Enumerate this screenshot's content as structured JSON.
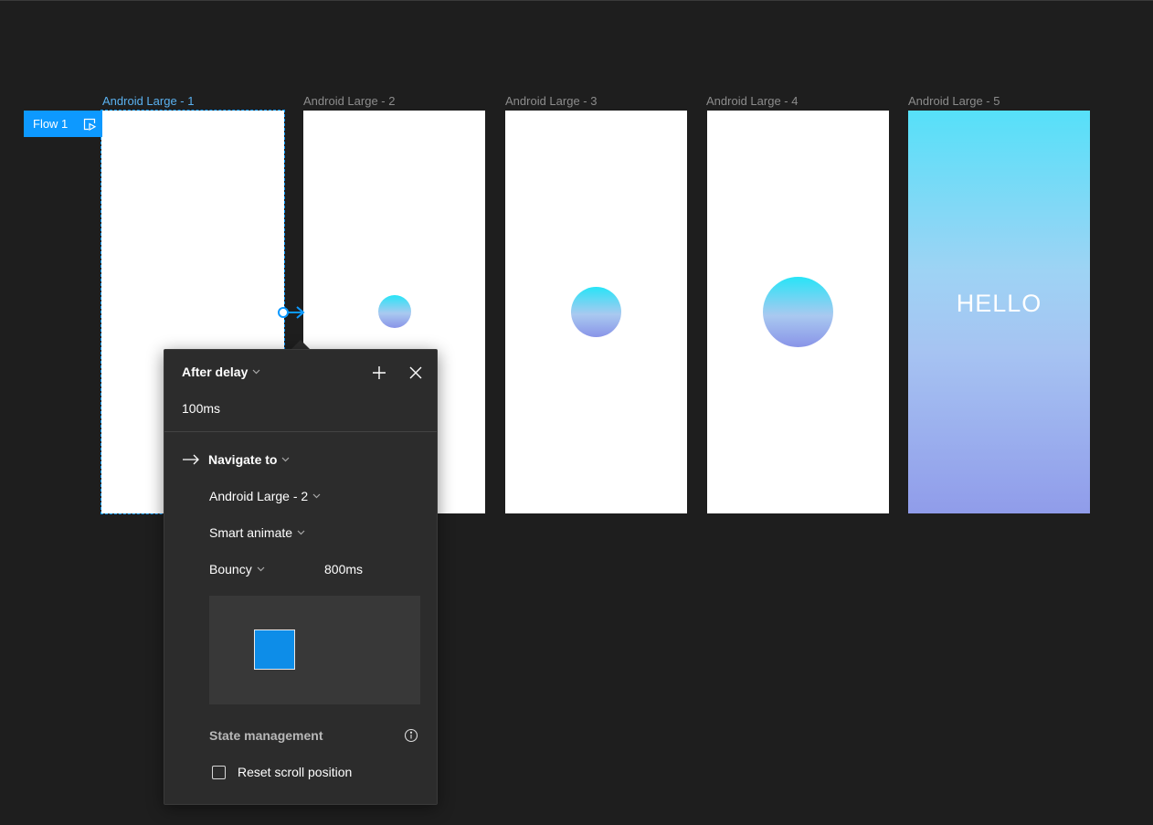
{
  "frames": [
    {
      "label": "Android Large - 1"
    },
    {
      "label": "Android Large - 2"
    },
    {
      "label": "Android Large - 3"
    },
    {
      "label": "Android Large - 4"
    },
    {
      "label": "Android Large - 5"
    }
  ],
  "frame5_text": "HELLO",
  "flow": {
    "label": "Flow 1",
    "icon": "play-frame-icon"
  },
  "colors": {
    "accent": "#0d99ff",
    "canvas": "#1e1e1e",
    "panel": "#2c2c2c",
    "gradient_top": "#56e0f9",
    "gradient_bottom": "#909cea"
  },
  "interaction_panel": {
    "trigger": "After delay",
    "delay": "100ms",
    "action": "Navigate to",
    "destination": "Android Large - 2",
    "animation": "Smart animate",
    "easing": "Bouncy",
    "duration": "800ms",
    "state_management_title": "State management",
    "reset_scroll_label": "Reset scroll position",
    "reset_scroll_checked": false,
    "icons": [
      "plus-icon",
      "close-icon",
      "arrow-right-icon",
      "chevron-down-icon",
      "info-icon"
    ]
  }
}
